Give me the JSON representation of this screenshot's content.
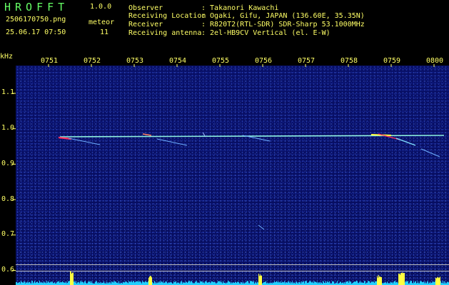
{
  "header": {
    "logo": "HROFFT",
    "version": "1.0.0",
    "filename": "2506170750.png",
    "datetime": "25.06.17 07:50",
    "meteor_label": "meteor",
    "meteor_count": "11",
    "observer_label": "Observer",
    "observer_value": ": Takanori Kawachi",
    "location_label": "Receiving Location",
    "location_value": ": Ogaki, Gifu, JAPAN (136.60E, 35.35N)",
    "receiver_label": "Receiver",
    "receiver_value": ": R820T2(RTL-SDR) SDR-Sharp 53.1000MHz",
    "antenna_label": "Receiving antenna",
    "antenna_value": ": 2el-HB9CV Vertical (el. E-W)"
  },
  "axis": {
    "y_unit": "kHz",
    "y_ticks": [
      "1.1",
      "1.0",
      "0.9",
      "0.8",
      "0.7",
      "0.6"
    ],
    "x_ticks": [
      "0751",
      "0752",
      "0753",
      "0754",
      "0755",
      "0756",
      "0757",
      "0758",
      "0759",
      "0800"
    ]
  },
  "colors": {
    "text": "#ffff66",
    "logo": "#66ff66",
    "background": "#070d5e",
    "carrier": "#80ffe0",
    "meteor_red": "#ff3060",
    "meteor_yellow": "#ffff40",
    "level_bars": "#20d0ff"
  }
}
